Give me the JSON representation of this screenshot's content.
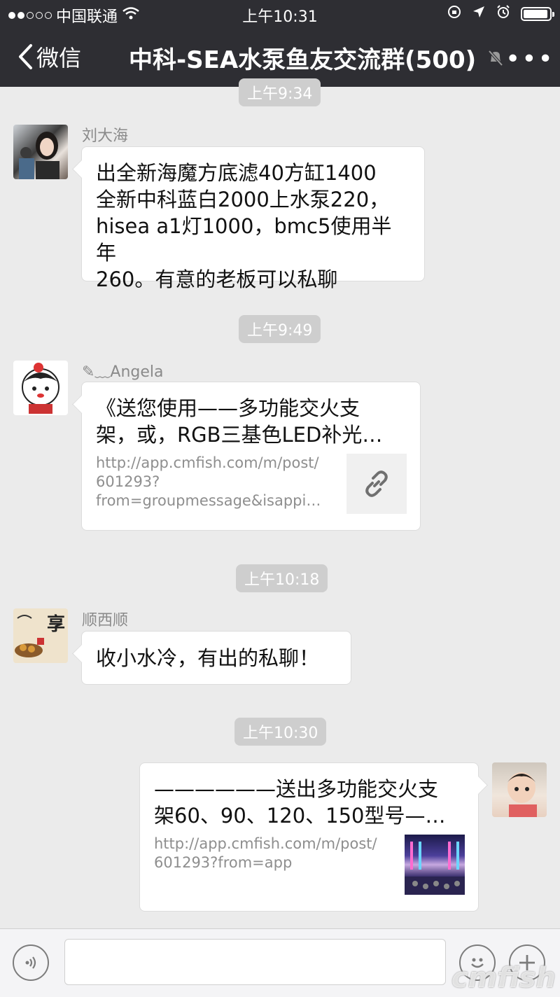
{
  "status": {
    "carrier": "中国联通",
    "time": "上午10:31"
  },
  "nav": {
    "back_label": "微信",
    "title": "中科-SEA水泵鱼友交流群(500)",
    "more": "•••"
  },
  "messages": {
    "t0": "上午9:34",
    "m1": {
      "sender": "刘大海",
      "lines": [
        "出全新海魔方底滤40方缸1400",
        "全新中科蓝白2000上水泵220，",
        "hisea a1灯1000，bmc5使用半年",
        "260。有意的老板可以私聊"
      ]
    },
    "t1": "上午9:49",
    "m2": {
      "sender": "✎﹏Angela",
      "link_title": [
        "《送您使用——多功能交火支",
        "架，或，RGB三基色LED补光…"
      ],
      "link_url": [
        "http://app.cmfish.com/m/post/",
        "601293?",
        "from=groupmessage&isappi…"
      ]
    },
    "t2": "上午10:18",
    "m3": {
      "sender": "顺西顺",
      "text": "收小水冷，有出的私聊！"
    },
    "t3": "上午10:30",
    "m4": {
      "link_title": [
        "——————送出多功能交火支",
        "架60、90、120、150型号—…"
      ],
      "link_url": [
        "http://app.cmfish.com/m/post/",
        "601293?from=app"
      ]
    }
  },
  "avatar3_text": "享",
  "watermark": "cmfish",
  "icons": [
    "wifi-icon",
    "back-chevron-icon",
    "mute-bell-icon",
    "link-icon",
    "voice-icon",
    "emoji-icon",
    "plus-icon"
  ]
}
